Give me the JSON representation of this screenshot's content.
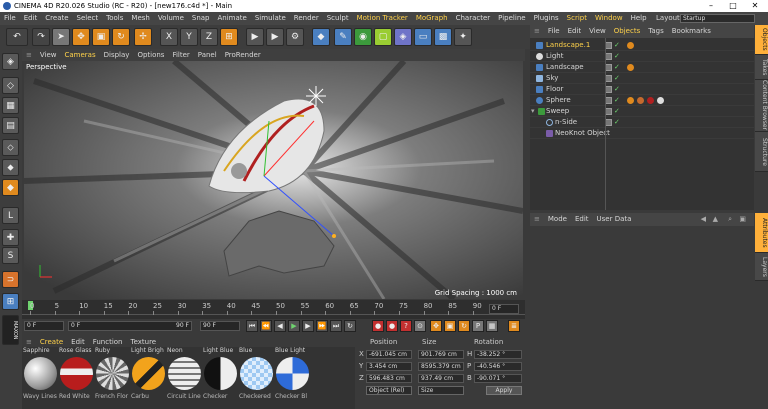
{
  "window": {
    "title": "CINEMA 4D R20.026 Studio (RC - R20) - [new176.c4d *] - Main"
  },
  "menu": [
    "File",
    "Edit",
    "Create",
    "Select",
    "Tools",
    "Mesh",
    "Volume",
    "Snap",
    "Animate",
    "Simulate",
    "Render",
    "Sculpt",
    "Motion Tracker",
    "MoGraph",
    "Character",
    "Pipeline",
    "Plugins",
    "Script",
    "Window",
    "Help"
  ],
  "layout": {
    "label": "Layout:",
    "value": "Startup"
  },
  "viewport": {
    "menu": [
      "View",
      "Cameras",
      "Display",
      "Options",
      "Filter",
      "Panel",
      "ProRender"
    ],
    "label": "Perspective",
    "grid_spacing": "Grid Spacing : 1000 cm"
  },
  "timeline": {
    "ticks": [
      "0",
      "5",
      "10",
      "15",
      "20",
      "25",
      "30",
      "35",
      "40",
      "45",
      "50",
      "55",
      "60",
      "65",
      "70",
      "75",
      "80",
      "85",
      "90"
    ],
    "end": "0 F"
  },
  "transport": {
    "current": "0 F",
    "min": "0 F",
    "max": "90 F",
    "end": "90 F"
  },
  "materials_menu": [
    "Create",
    "Edit",
    "Function",
    "Texture"
  ],
  "materials": [
    {
      "name": "Sapphire",
      "bottom": "Wavy Lines"
    },
    {
      "name": "Rose Glass",
      "bottom": "Red White"
    },
    {
      "name": "Ruby",
      "bottom": "French Flor"
    },
    {
      "name": "Light Brigh",
      "bottom": "Carbu"
    },
    {
      "name": "Neon",
      "bottom": "Circuit Line"
    },
    {
      "name": "Light Blue",
      "bottom": "Checker"
    },
    {
      "name": "Blue",
      "bottom": "Checkered"
    },
    {
      "name": "Blue Light",
      "bottom": "Checker Bl"
    }
  ],
  "coords": {
    "headers": {
      "position": "Position",
      "size": "Size",
      "rotation": "Rotation"
    },
    "rows": [
      {
        "axis": "X",
        "pos": "-691.045 cm",
        "size": "901.769 cm",
        "rot_axis": "H",
        "rot": "-38.252 °"
      },
      {
        "axis": "Y",
        "pos": "3.454 cm",
        "size": "8595.379 cm",
        "rot_axis": "P",
        "rot": "-40.546 °"
      },
      {
        "axis": "Z",
        "pos": "596.483 cm",
        "size": "937.49 cm",
        "rot_axis": "B",
        "rot": "-90.071 °"
      }
    ],
    "mode": "Object (Rel)",
    "size_mode": "Size",
    "apply": "Apply"
  },
  "object_manager": {
    "menu": [
      "File",
      "Edit",
      "View",
      "Objects",
      "Tags",
      "Bookmarks"
    ],
    "objects": [
      {
        "name": "Landscape.1",
        "color": "#ffd24a"
      },
      {
        "name": "Light",
        "color": "#cfcfcf"
      },
      {
        "name": "Landscape",
        "color": "#cfcfcf"
      },
      {
        "name": "Sky",
        "color": "#cfcfcf"
      },
      {
        "name": "Floor",
        "color": "#cfcfcf"
      },
      {
        "name": "Sphere",
        "color": "#cfcfcf"
      },
      {
        "name": "Sweep",
        "color": "#cfcfcf"
      },
      {
        "name": "n-Side",
        "color": "#cfcfcf"
      },
      {
        "name": "NeoKnot Object",
        "color": "#cfcfcf"
      }
    ]
  },
  "attributes": {
    "menu": [
      "Mode",
      "Edit",
      "User Data"
    ]
  },
  "right_tabs": [
    "Objects",
    "Takes",
    "Content Browser",
    "Structure",
    "Attributes",
    "Layers"
  ]
}
